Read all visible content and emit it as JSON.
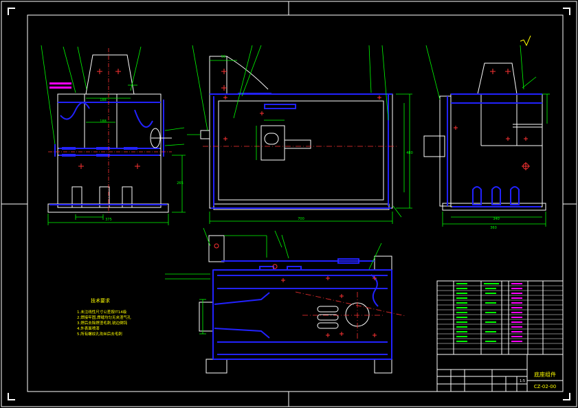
{
  "sheet": {
    "background": "#000000",
    "frame_color": "#ffffff",
    "outline_color": "#2222ff",
    "dim_color": "#00ff00",
    "center_color": "#ff3333",
    "annot_color": "#ff00ff",
    "text_color": "#ffffff",
    "highlight_color": "#ffff00"
  },
  "title_block": {
    "drawing_name": "底座组件",
    "drawing_number": "CZ-02-00",
    "scale": "1:5",
    "sheet_no": "1"
  },
  "dimensions": {
    "front_width": "375",
    "front_height": "265",
    "front_inner": "188",
    "front_top": "188",
    "side_width": "700",
    "side_height": "480",
    "side_top": "56",
    "right_width": "360",
    "right_inner": "340",
    "bottom_offset": "13"
  },
  "tech_notes": {
    "title": "技术要求",
    "items": [
      "1.未注线性尺寸公差按IT14级",
      "2.焊接牢固,焊缝均匀无夹渣气孔",
      "3.焊后去除焊渣毛刺,锐边倒钝",
      "4.外表面喷漆",
      "5.所有螺纹孔攻丝后去毛刺"
    ]
  }
}
